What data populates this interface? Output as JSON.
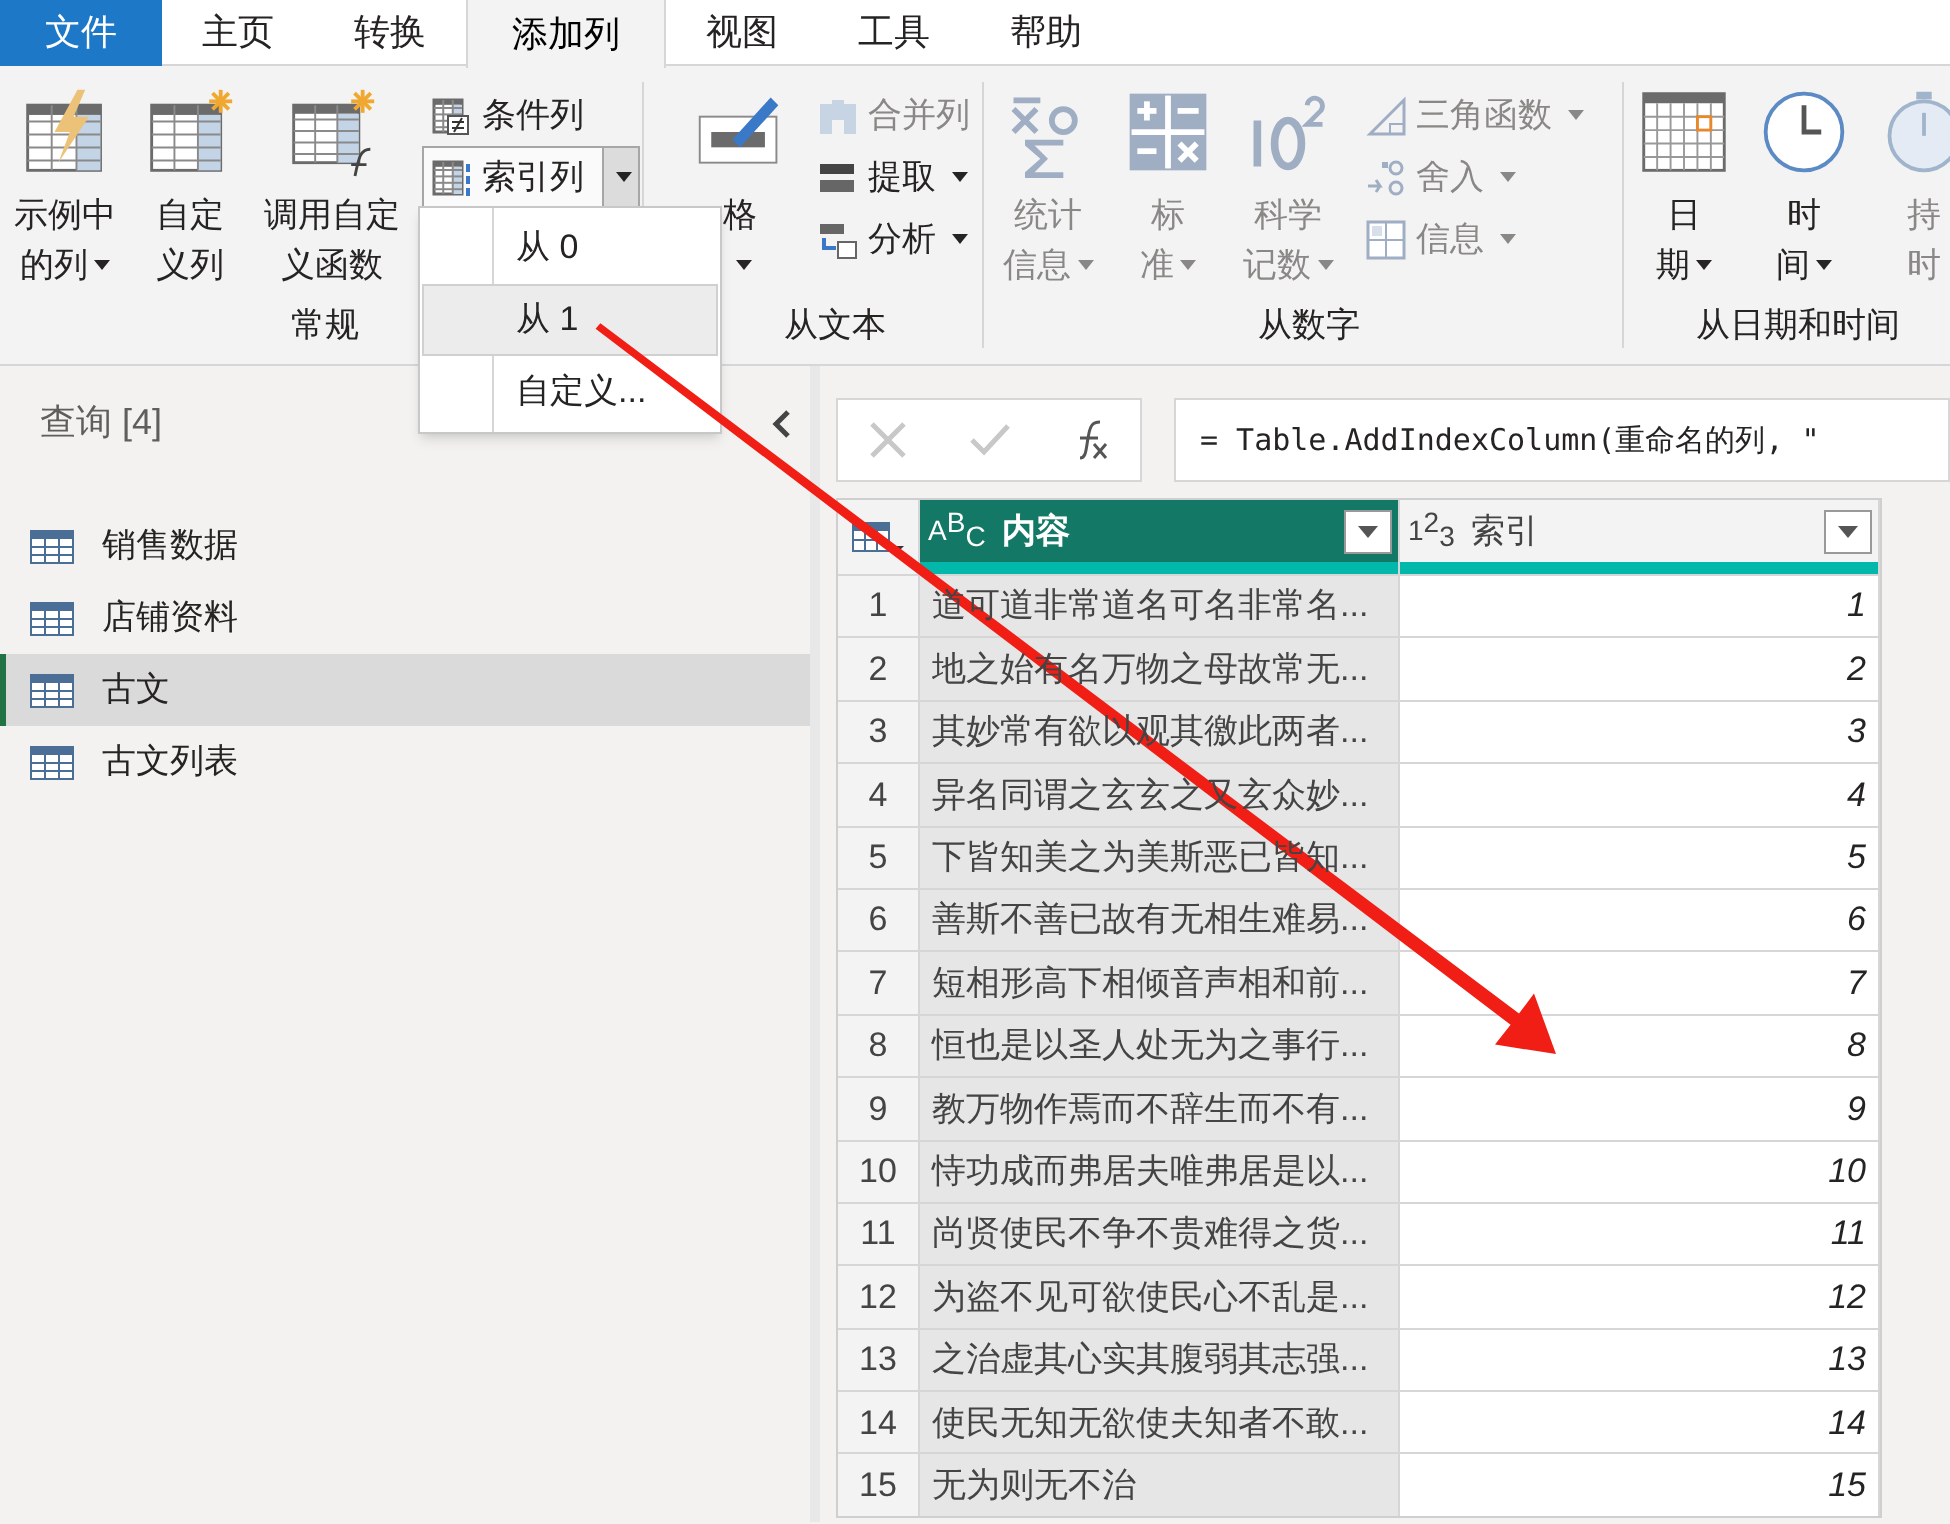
{
  "tabs": [
    {
      "label": "文件",
      "kind": "file",
      "selected": false
    },
    {
      "label": "主页",
      "kind": "tab",
      "selected": false
    },
    {
      "label": "转换",
      "kind": "tab",
      "selected": false
    },
    {
      "label": "添加列",
      "kind": "tab",
      "selected": true
    },
    {
      "label": "视图",
      "kind": "tab",
      "selected": false
    },
    {
      "label": "工具",
      "kind": "tab",
      "selected": false
    },
    {
      "label": "帮助",
      "kind": "tab",
      "selected": false
    }
  ],
  "ribbon": {
    "groups": [
      {
        "label": "常规",
        "buttons": [
          {
            "kind": "large",
            "lines": [
              "示例中",
              "的列"
            ],
            "dropdown": true,
            "disabled": false
          },
          {
            "kind": "large",
            "lines": [
              "自定",
              "义列"
            ],
            "dropdown": false,
            "disabled": false
          },
          {
            "kind": "large",
            "lines": [
              "调用自定",
              "义函数"
            ],
            "dropdown": false,
            "disabled": false
          },
          {
            "kind": "stack",
            "items": [
              {
                "label": "条件列",
                "dropdown": false,
                "disabled": false,
                "expanded": false
              },
              {
                "label": "索引列",
                "dropdown": true,
                "disabled": false,
                "expanded": true,
                "menu": [
                  {
                    "label": "从 0",
                    "selected": false
                  },
                  {
                    "label": "从 1",
                    "selected": true
                  },
                  {
                    "label": "自定义...",
                    "selected": false
                  }
                ]
              }
            ]
          }
        ]
      },
      {
        "label": "从文本",
        "buttons": [
          {
            "kind": "large",
            "lines": [
              "格"
            ],
            "dropdown": true,
            "disabled": false
          },
          {
            "kind": "stack",
            "items": [
              {
                "label": "合并列",
                "dropdown": false,
                "disabled": true,
                "expanded": false
              },
              {
                "label": "提取",
                "dropdown": true,
                "disabled": false,
                "expanded": false
              },
              {
                "label": "分析",
                "dropdown": true,
                "disabled": false,
                "expanded": false
              }
            ]
          }
        ]
      },
      {
        "label": "从数字",
        "buttons": [
          {
            "kind": "large",
            "lines": [
              "统计",
              "信息"
            ],
            "dropdown": true,
            "disabled": true
          },
          {
            "kind": "large",
            "lines": [
              "标",
              "准"
            ],
            "dropdown": true,
            "disabled": true
          },
          {
            "kind": "large",
            "lines": [
              "科学",
              "记数"
            ],
            "dropdown": true,
            "disabled": true
          },
          {
            "kind": "stack",
            "items": [
              {
                "label": "三角函数",
                "dropdown": true,
                "disabled": true,
                "expanded": false
              },
              {
                "label": "舍入",
                "dropdown": true,
                "disabled": true,
                "expanded": false
              },
              {
                "label": "信息",
                "dropdown": true,
                "disabled": true,
                "expanded": false
              }
            ]
          }
        ]
      },
      {
        "label": "从日期和时间",
        "buttons": [
          {
            "kind": "large",
            "lines": [
              "日",
              "期"
            ],
            "dropdown": true,
            "disabled": false
          },
          {
            "kind": "large",
            "lines": [
              "时",
              "间"
            ],
            "dropdown": true,
            "disabled": false
          },
          {
            "kind": "large",
            "lines": [
              "持",
              "时"
            ],
            "dropdown": false,
            "disabled": true
          }
        ]
      }
    ]
  },
  "queries": {
    "title": "查询 [4]",
    "items": [
      {
        "label": "销售数据",
        "selected": false
      },
      {
        "label": "店铺资料",
        "selected": false
      },
      {
        "label": "古文",
        "selected": true
      },
      {
        "label": "古文列表",
        "selected": false
      }
    ]
  },
  "formula": "= Table.AddIndexColumn(重命名的列, \"",
  "table": {
    "columns": [
      {
        "type_icon": "ABC",
        "label": "内容",
        "selected": true
      },
      {
        "type_icon": "123",
        "label": "索引",
        "selected": false
      }
    ],
    "rows": [
      {
        "row_number": "1",
        "cells": [
          "道可道非常道名可名非常名...",
          "1"
        ]
      },
      {
        "row_number": "2",
        "cells": [
          "地之始有名万物之母故常无...",
          "2"
        ]
      },
      {
        "row_number": "3",
        "cells": [
          "其妙常有欲以观其徼此两者...",
          "3"
        ]
      },
      {
        "row_number": "4",
        "cells": [
          "异名同谓之玄玄之又玄众妙...",
          "4"
        ]
      },
      {
        "row_number": "5",
        "cells": [
          "下皆知美之为美斯恶已皆知...",
          "5"
        ]
      },
      {
        "row_number": "6",
        "cells": [
          "善斯不善已故有无相生难易...",
          "6"
        ]
      },
      {
        "row_number": "7",
        "cells": [
          "短相形高下相倾音声相和前...",
          "7"
        ]
      },
      {
        "row_number": "8",
        "cells": [
          "恒也是以圣人处无为之事行...",
          "8"
        ]
      },
      {
        "row_number": "9",
        "cells": [
          "教万物作焉而不辞生而不有...",
          "9"
        ]
      },
      {
        "row_number": "10",
        "cells": [
          "恃功成而弗居夫唯弗居是以...",
          "10"
        ]
      },
      {
        "row_number": "11",
        "cells": [
          "尚贤使民不争不贵难得之货...",
          "11"
        ]
      },
      {
        "row_number": "12",
        "cells": [
          "为盗不见可欲使民心不乱是...",
          "12"
        ]
      },
      {
        "row_number": "13",
        "cells": [
          "之治虚其心实其腹弱其志强...",
          "13"
        ]
      },
      {
        "row_number": "14",
        "cells": [
          "使民无知无欲使夫知者不敢...",
          "14"
        ]
      },
      {
        "row_number": "15",
        "cells": [
          "无为则无不治",
          "15"
        ]
      }
    ]
  }
}
